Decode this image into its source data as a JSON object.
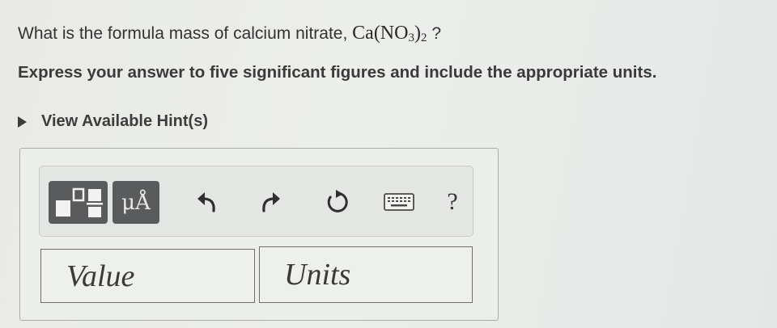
{
  "question": {
    "text": "What is the formula mass of calcium nitrate,",
    "formula_main": "Ca(NO",
    "formula_sub1": "3",
    "formula_close": ")",
    "formula_sub2": "2",
    "suffix": "?"
  },
  "instruction": "Express your answer to five significant figures and include the appropriate units.",
  "hint_toggle": "View Available Hint(s)",
  "toolbar": {
    "templates_icon": "templates-icon",
    "units_label": "μÅ",
    "undo_icon": "undo-icon",
    "redo_icon": "redo-icon",
    "reset_icon": "reset-icon",
    "keyboard_icon": "keyboard-icon",
    "help_label": "?"
  },
  "fields": {
    "value_placeholder": "Value",
    "units_placeholder": "Units"
  }
}
